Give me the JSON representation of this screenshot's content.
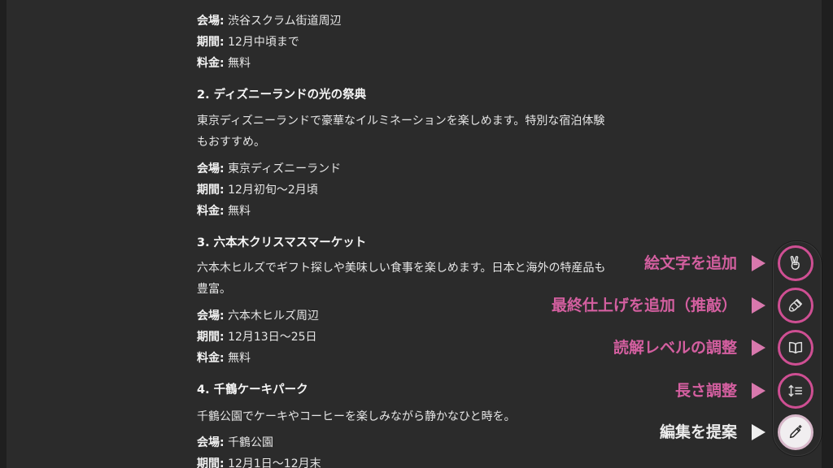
{
  "article": {
    "item1": {
      "venue_label": "会場:",
      "venue": "渋谷スクラム街道周辺",
      "period_label": "期間:",
      "period": "12月中頃まで",
      "fee_label": "料金:",
      "fee": "無料"
    },
    "item2": {
      "heading": "2. ディズニーランドの光の祭典",
      "desc_line1": "東京ディズニーランドで豪華なイルミネーションを楽しめます。特別な宿泊体験",
      "desc_line2": "もおすすめ。",
      "venue_label": "会場:",
      "venue": "東京ディズニーランド",
      "period_label": "期間:",
      "period": "12月初旬〜2月頃",
      "fee_label": "料金:",
      "fee": "無料"
    },
    "item3": {
      "heading": "3. 六本木クリスマスマーケット",
      "desc_line1": "六本木ヒルズでギフト探しや美味しい食事を楽しめます。日本と海外の特産品も",
      "desc_line2": "豊富。",
      "venue_label": "会場:",
      "venue": "六本木ヒルズ周辺",
      "period_label": "期間:",
      "period": "12月13日〜25日",
      "fee_label": "料金:",
      "fee": "無料"
    },
    "item4": {
      "heading": "4. 千鶴ケーキパーク",
      "desc_line1": "千鶴公園でケーキやコーヒーを楽しみながら静かなひと時を。",
      "venue_label": "会場:",
      "venue": "千鶴公園",
      "period_label": "期間:",
      "period": "12月1日〜12月末"
    }
  },
  "tools": {
    "emoji": {
      "label": "絵文字を追加",
      "icon": "peace-hand-icon"
    },
    "polish": {
      "label": "最終仕上げを追加（推敲）",
      "icon": "brush-icon"
    },
    "reading": {
      "label": "読解レベルの調整",
      "icon": "book-icon"
    },
    "length": {
      "label": "長さ調整",
      "icon": "line-height-icon"
    },
    "suggest": {
      "label": "編集を提案",
      "icon": "pencil-sparkle-icon"
    }
  },
  "colors": {
    "accent": "#cf4f93",
    "label_accent": "#d45fa0",
    "background": "#2b2b2b",
    "text": "#e6e6e6"
  }
}
